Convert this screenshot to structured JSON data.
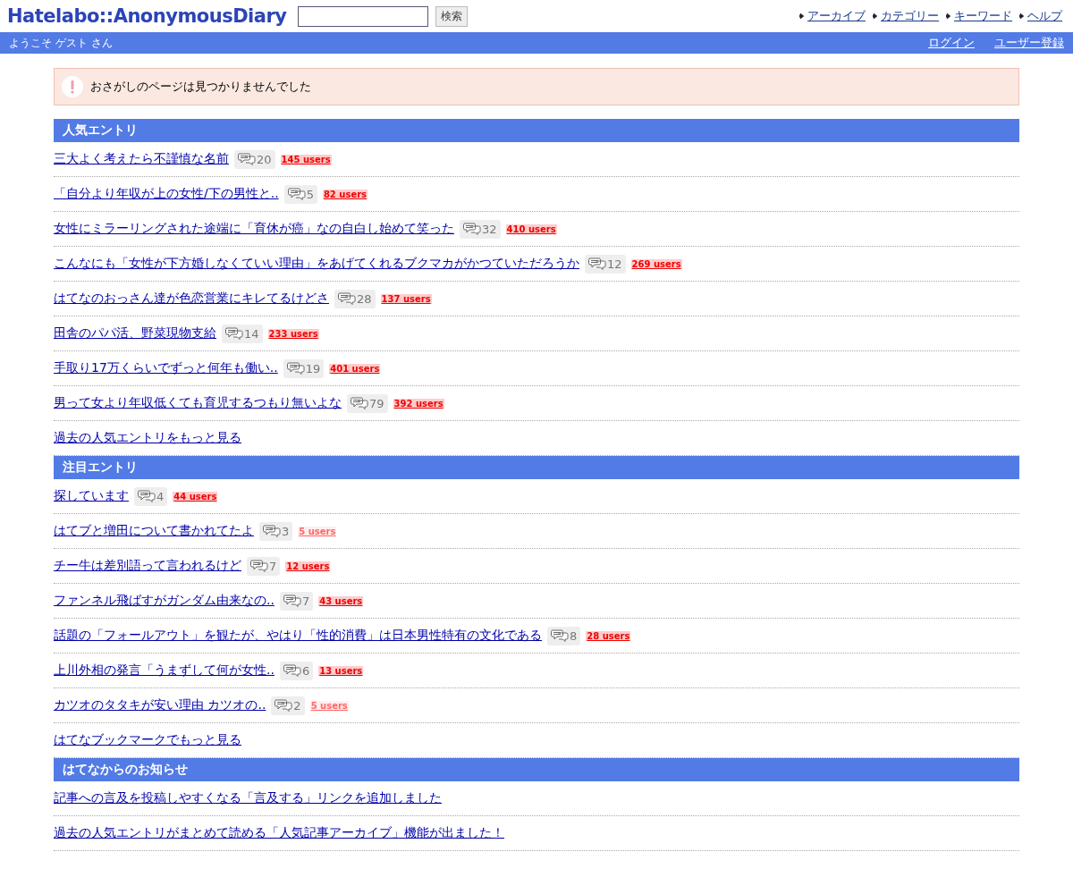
{
  "header": {
    "logo": "Hatelabo::AnonymousDiary",
    "search": {
      "button": "検索"
    },
    "nav": [
      "アーカイブ",
      "カテゴリー",
      "キーワード",
      "ヘルプ"
    ]
  },
  "userbar": {
    "welcome": "ようこそ ゲスト さん",
    "links": [
      "ログイン",
      "ユーザー登録"
    ]
  },
  "alert": {
    "message": "おさがしのページは見つかりませんでした"
  },
  "sections": [
    {
      "title": "人気エントリ",
      "entries": [
        {
          "title": "三大よく考えたら不謹慎な名前",
          "comments": "20",
          "users": "145 users",
          "kind": "hot"
        },
        {
          "title": "「自分より年収が上の女性/下の男性と..",
          "comments": "5",
          "users": "82 users",
          "kind": "hot"
        },
        {
          "title": "女性にミラーリングされた途端に「育休が癌」なの自白し始めて笑った",
          "comments": "32",
          "users": "410 users",
          "kind": "hot"
        },
        {
          "title": "こんなにも「女性が下方婚しなくていい理由」をあげてくれるブクマカがかつていただろうか",
          "comments": "12",
          "users": "269 users",
          "kind": "hot"
        },
        {
          "title": "はてなのおっさん達が色恋営業にキレてるけどさ",
          "comments": "28",
          "users": "137 users",
          "kind": "hot"
        },
        {
          "title": "田舎のパパ活、野菜現物支給",
          "comments": "14",
          "users": "233 users",
          "kind": "hot"
        },
        {
          "title": "手取り17万くらいでずっと何年も働い..",
          "comments": "19",
          "users": "401 users",
          "kind": "hot"
        },
        {
          "title": "男って女より年収低くても育児するつもり無いよな",
          "comments": "79",
          "users": "392 users",
          "kind": "hot"
        }
      ],
      "more": "過去の人気エントリをもっと見る"
    },
    {
      "title": "注目エントリ",
      "entries": [
        {
          "title": "探しています",
          "comments": "4",
          "users": "44 users",
          "kind": "hot"
        },
        {
          "title": "はてブと増田について書かれてたよ",
          "comments": "3",
          "users": "5 users",
          "kind": "mild"
        },
        {
          "title": "チー牛は差別語って言われるけど",
          "comments": "7",
          "users": "12 users",
          "kind": "hot"
        },
        {
          "title": "ファンネル飛ばすがガンダム由来なの..",
          "comments": "7",
          "users": "43 users",
          "kind": "hot"
        },
        {
          "title": "話題の「フォールアウト」を観たが、やはり「性的消費」は日本男性特有の文化である",
          "comments": "8",
          "users": "28 users",
          "kind": "hot"
        },
        {
          "title": "上川外相の発言「うまずして何が女性..",
          "comments": "6",
          "users": "13 users",
          "kind": "hot"
        },
        {
          "title": "カツオのタタキが安い理由 カツオの..",
          "comments": "2",
          "users": "5 users",
          "kind": "mild"
        }
      ],
      "more": "はてなブックマークでもっと見る"
    },
    {
      "title": "はてなからのお知らせ",
      "entries": [
        {
          "title": "記事への言及を投稿しやすくなる「言及する」リンクを追加しました"
        },
        {
          "title": "過去の人気エントリがまとめて読める「人気記事アーカイブ」機能が出ました！"
        }
      ]
    }
  ]
}
